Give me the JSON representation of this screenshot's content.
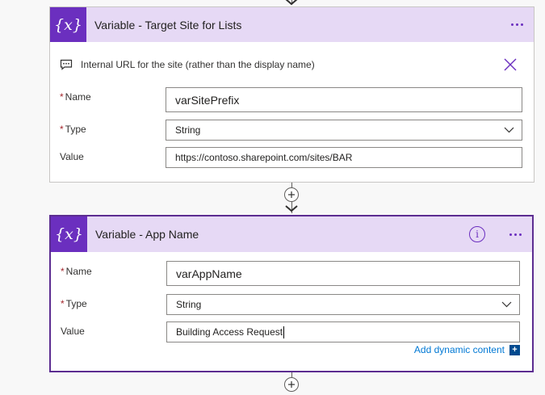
{
  "card1": {
    "title": "Variable - Target Site for Lists",
    "icon_symbol": "{x}",
    "comment": "Internal URL for the site (rather than the display name)",
    "fields": {
      "name": {
        "label": "Name",
        "value": "varSitePrefix"
      },
      "type": {
        "label": "Type",
        "value": "String"
      },
      "value": {
        "label": "Value",
        "value": "https://contoso.sharepoint.com/sites/BAR"
      }
    }
  },
  "card2": {
    "title": "Variable - App Name",
    "icon_symbol": "{x}",
    "info_symbol": "i",
    "fields": {
      "name": {
        "label": "Name",
        "value": "varAppName"
      },
      "type": {
        "label": "Type",
        "value": "String"
      },
      "value": {
        "label": "Value",
        "value": "Building Access Request"
      }
    },
    "add_dynamic": "Add dynamic content",
    "add_dynamic_symbol": "+"
  },
  "colors": {
    "accent": "#6b2fbf",
    "header_bg": "#e6d9f5",
    "selected_border": "#5c2d91",
    "link": "#0078d4",
    "required": "#a4262c"
  },
  "icons": [
    "flow-arrow-icon",
    "variable-icon",
    "comment-icon",
    "close-icon",
    "more-icon",
    "chevron-down-icon",
    "add-step-icon",
    "info-icon"
  ]
}
